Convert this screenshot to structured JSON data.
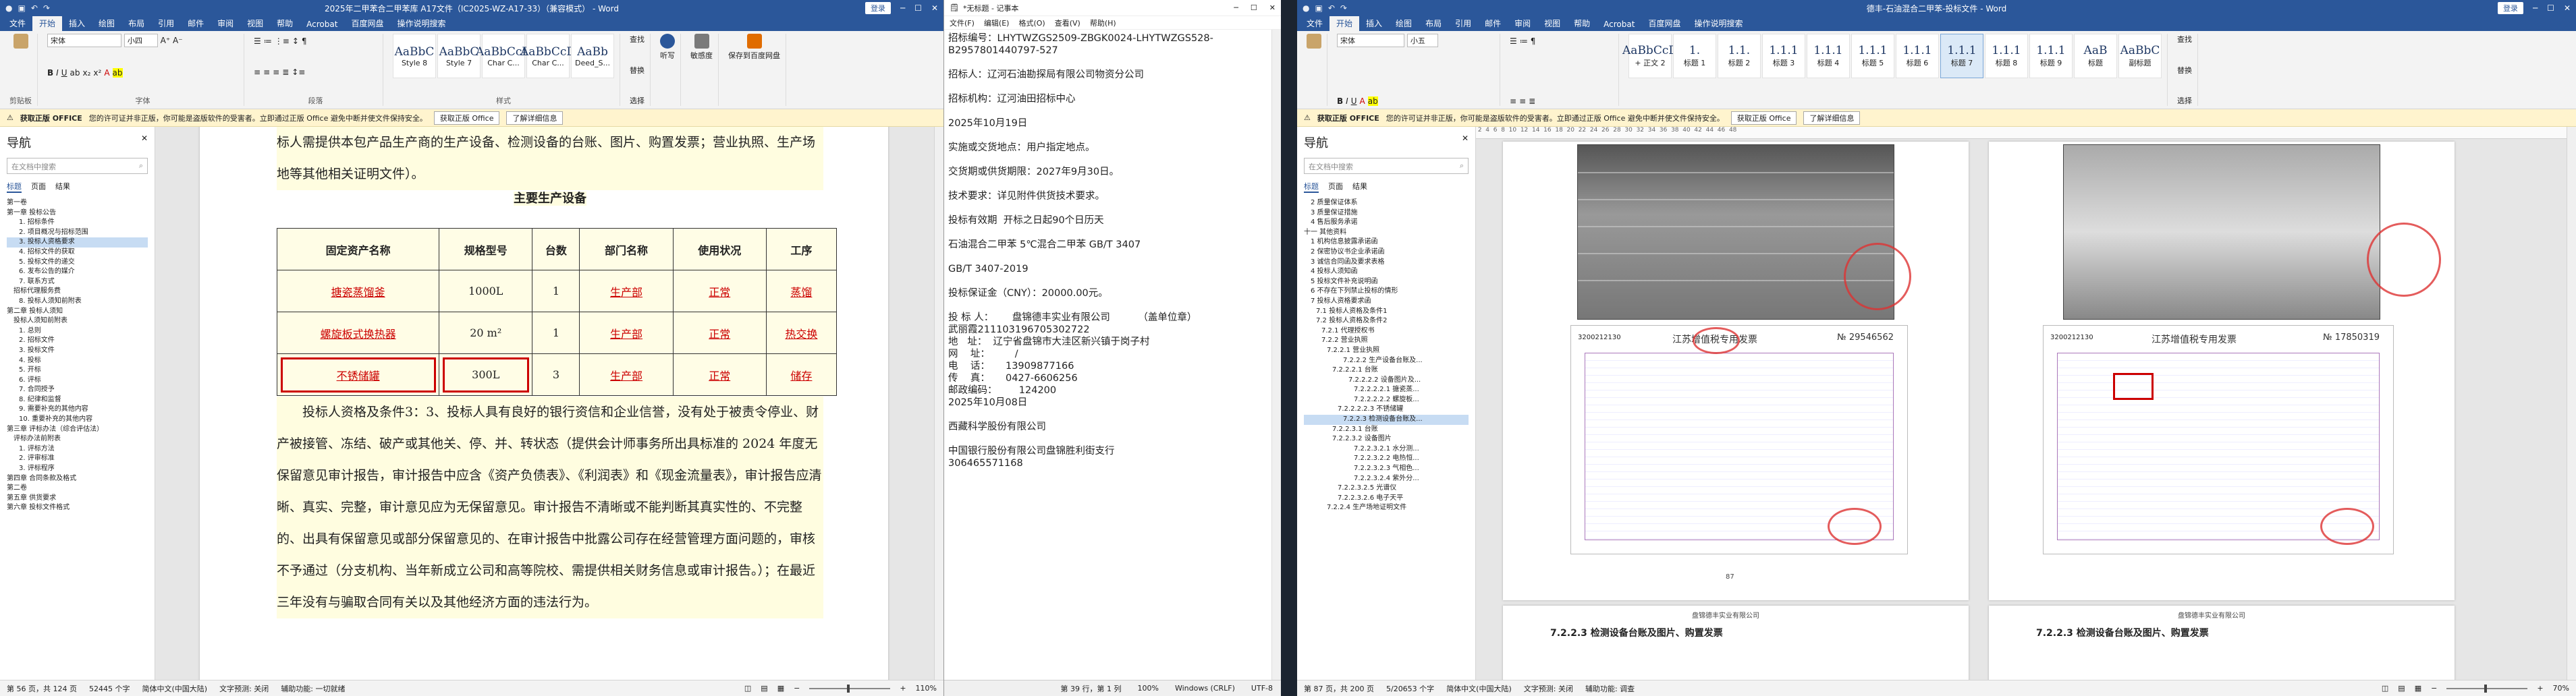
{
  "w1": {
    "title": "2025年二甲苯合二甲苯库 A17文件（IC2025-WZ-A17-33）（兼容模式） - Word",
    "login": "登录",
    "tabs": [
      "文件",
      "开始",
      "插入",
      "绘图",
      "布局",
      "引用",
      "邮件",
      "审阅",
      "视图",
      "帮助",
      "Acrobat",
      "百度网盘",
      "操作说明搜索"
    ],
    "font": "宋体",
    "size": "小四",
    "styles": [
      {
        "big": "AaBbC",
        "name": "Style 8"
      },
      {
        "big": "AaBbC",
        "name": "Style 7"
      },
      {
        "big": "AaBbCcD",
        "name": "Char C..."
      },
      {
        "big": "AaBbCcD",
        "name": "Char C..."
      },
      {
        "big": "AaBb",
        "name": "Deed_S..."
      }
    ],
    "groups": [
      "剪贴板",
      "字体",
      "段落",
      "样式",
      "编辑",
      "保存",
      "保存"
    ],
    "edit": [
      "查找",
      "替换",
      "选择"
    ],
    "dictate": "听写",
    "sensitivity": "敏感度",
    "save_baidu": "保存到百度网盘",
    "notice": {
      "bold": "获取正版 OFFICE",
      "text": "您的许可证并非正版，你可能是盗版软件的受害者。立即通过正版 Office 避免中断并使文件保持安全。",
      "btn1": "获取正版 Office",
      "btn2": "了解详细信息"
    },
    "nav": {
      "title": "导航",
      "search": "在文档中搜索",
      "tabs": [
        "标题",
        "页面",
        "结果"
      ],
      "items": [
        "第一卷",
        "第一章 投标公告",
        "1. 招标条件",
        "2. 项目概况与招标范围",
        "3. 投标人资格要求",
        "4. 招标文件的获取",
        "5. 投标文件的递交",
        "6. 发布公告的媒介",
        "7. 联系方式",
        "招标代理服务费",
        "8. 投标人须知前附表",
        "第二章 投标人须知",
        "投标人须知前附表",
        "1. 总则",
        "2. 招标文件",
        "3. 投标文件",
        "4. 投标",
        "5. 开标",
        "6. 评标",
        "7. 合同授予",
        "8. 纪律和监督",
        "9. 需要补充的其他内容",
        "10. 重要补充的其他内容",
        "第三章 评标办法（综合评估法）",
        "评标办法前附表",
        "1. 评标方法",
        "2. 评审标准",
        "3. 评标程序",
        "第四章 合同条款及格式",
        "第二卷",
        "第五章 供货要求",
        "第六章 投标文件格式"
      ],
      "selected": 4
    },
    "para1": "标人需提供本包产品生产商的生产设备、检测设备的台账、图片、购置发票；营业执照、生产场地等其他相关证明文件）。",
    "table_title": "主要生产设备",
    "headers": [
      "固定资产名称",
      "规格型号",
      "台数",
      "部门名称",
      "使用状况",
      "工序"
    ],
    "rows": [
      [
        "搪瓷蒸馏釜",
        "1000L",
        "1",
        "生产部",
        "正常",
        "蒸馏"
      ],
      [
        "螺旋板式换热器",
        "20 m²",
        "1",
        "生产部",
        "正常",
        "热交换"
      ],
      [
        "不锈储罐",
        "300L",
        "3",
        "生产部",
        "正常",
        "储存"
      ]
    ],
    "para2": "投标人资格及条件3：3、投标人具有良好的银行资信和企业信誉，没有处于被责令停业、财产被接管、冻结、破产或其他关、停、并、转状态（提供会计师事务所出具标准的 2024 年度无保留意见审计报告，审计报告中应含《资产负债表》、《利润表》和《现金流量表》，审计报告应清晰、真实、完整，审计意见应为无保留意见。审计报告不清晰或不能判断其真实性的、不完整的、出具有保留意见或部分保留意见的、在审计报告中批露公司存在经营管理方面问题的，审核不予通过（分支机构、当年新成立公司和高等院校、需提供相关财务信息或审计报告。）；在最近三年没有与骗取合同有关以及其他经济方面的违法行为。",
    "status": {
      "page": "第 56 页，共 124 页",
      "words": "52445 个字",
      "lang": "简体中文(中国大陆)",
      "pred": "文字预测: 关闭",
      "access": "辅助功能: 一切就绪",
      "zoom": "110%"
    }
  },
  "w2": {
    "title": "*无标题 - 记事本",
    "menu": [
      "文件(F)",
      "编辑(E)",
      "格式(O)",
      "查看(V)",
      "帮助(H)"
    ],
    "lines": [
      "招标编号：LHYTWZGS2509-ZBGK0024-LHYTWZGS528-B2957801440797-527",
      "",
      "招标人：辽河石油勘探局有限公司物资分公司",
      "",
      "招标机构：辽河油田招标中心",
      "",
      "2025年10月19日",
      "",
      "实施或交货地点：用户指定地点。",
      "",
      "交货期或供货期限：2027年9月30日。",
      "",
      "技术要求：详见附件供货技术要求。",
      "",
      "投标有效期  开标之日起90个日历天",
      "",
      "石油混合二甲苯 5℃混合二甲苯 GB/T 3407",
      "",
      "GB/T 3407-2019",
      "",
      "投标保证金（CNY）：20000.00元。",
      "",
      "投 标 人：      盘锦德丰实业有限公司         （盖单位章）",
      "武丽霞21110319670530272​2",
      "地   址：  辽宁省盘锦市大洼区新兴镇于岗子村",
      "网    址：        /",
      "电    话：     13909877166",
      "传    真：     0427-6606256",
      "邮政编码：       124200",
      "2025年10月08日",
      "",
      "西藏科学股份有限公司",
      "",
      "中国银行股份有限公司盘锦胜利街支行",
      "306465571168"
    ],
    "status": {
      "pos": "第 39 行，第 1 列",
      "zoom": "100%",
      "eol": "Windows (CRLF)",
      "enc": "UTF-8"
    }
  },
  "w3": {
    "title": "德丰-石油混合二甲苯-投标文件 - Word",
    "login": "登录",
    "tabs": [
      "文件",
      "开始",
      "插入",
      "绘图",
      "布局",
      "引用",
      "邮件",
      "审阅",
      "视图",
      "帮助",
      "Acrobat",
      "百度网盘",
      "操作说明搜索"
    ],
    "font": "宋体",
    "size": "小五",
    "styles": [
      {
        "big": "AaBbCcD",
        "name": "+ 正文 2"
      },
      {
        "big": "1.",
        "name": "标题 1"
      },
      {
        "big": "1.1.",
        "name": "标题 2"
      },
      {
        "big": "1.1.1",
        "name": "标题 3"
      },
      {
        "big": "1.1.1",
        "name": "标题 4"
      },
      {
        "big": "1.1.1",
        "name": "标题 5"
      },
      {
        "big": "1.1.1",
        "name": "标题 6"
      },
      {
        "big": "1.1.1",
        "name": "标题 7"
      },
      {
        "big": "1.1.1",
        "name": "标题 8"
      },
      {
        "big": "1.1.1",
        "name": "标题 9"
      },
      {
        "big": "AaB",
        "name": "标题"
      },
      {
        "big": "AaBbC",
        "name": "副标题"
      }
    ],
    "edit": [
      "查找",
      "替换",
      "选择"
    ],
    "nav": {
      "title": "导航",
      "search": "在文档中搜索",
      "tabs": [
        "标题",
        "页面",
        "结果"
      ],
      "items": [
        "2 质量保证体系",
        "3 质量保证措施",
        "4 售后服务承诺",
        "十一 其他资料",
        "1 机构信息披露承诺函",
        "2 保密协议书企业承诺函",
        "3 诚信合同函及要求表格",
        "4 投标人须知函",
        "5 投标文件补充说明函",
        "6 不存在下列禁止投标的情形",
        "7 投标人资格要求函",
        "7.1 投标人资格及条件1",
        "7.2 投标人资格及条件2",
        "7.2.1 代理授权书",
        "7.2.2 营业执照",
        "7.2.2.1 营业执照",
        "7.2.2.2 生产设备台账及...",
        "7.2.2.2.1 台账",
        "7.2.2.2.2 设备图片及...",
        "7.2.2.2.2.1 搪瓷蒸...",
        "7.2.2.2.2.2 螺旋板...",
        "7.2.2.2.2.3 不锈储罐",
        "7.2.2.3 检测设备台账及...",
        "7.2.2.3.1 台账",
        "7.2.2.3.2 设备图片",
        "7.2.2.3.2.1 水分测...",
        "7.2.2.3.2.2 电热恒...",
        "7.2.2.3.2.3 气相色...",
        "7.2.2.3.2.4 紫外分...",
        "7.2.2.3.2.5 光谱仪",
        "7.2.2.3.2.6 电子天平",
        "7.2.2.4 生产场地证明文件"
      ],
      "selected": 22
    },
    "inv_title": "江苏增值税专用发票",
    "inv_no1": "№ 29546562",
    "inv_no2": "№ 17850319",
    "inv_code1": "3200212130",
    "inv_code2": "3200212130",
    "footer": "盘锦德丰实业有限公司",
    "bottom_text1": "7.2.2.3 检测设备台账及图片、购置发票",
    "bottom_text2": "7.2.2.3 检测设备台账及图片、购置发票",
    "status": {
      "page": "第 87 页，共 200 页",
      "words": "5/20653 个字",
      "lang": "简体中文(中国大陆)",
      "pred": "文字预测: 关闭",
      "access": "辅助功能: 调查",
      "zoom": "70%"
    }
  }
}
